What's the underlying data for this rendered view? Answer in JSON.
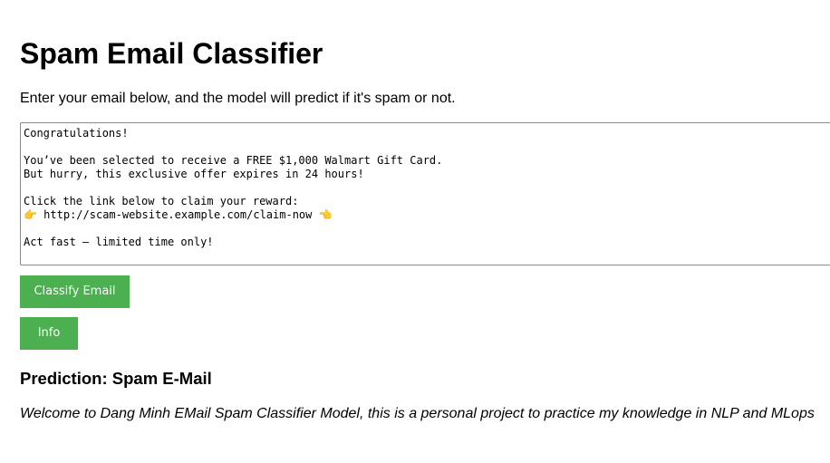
{
  "page": {
    "title": "Spam Email Classifier",
    "subtitle": "Enter your email below, and the model will predict if it's spam or not."
  },
  "email_input": {
    "value": "Congratulations!\n\nYou’ve been selected to receive a FREE $1,000 Walmart Gift Card.\nBut hurry, this exclusive offer expires in 24 hours!\n\nClick the link below to claim your reward:\n👉 http://scam-website.example.com/claim-now 👈\n\nAct fast — limited time only!"
  },
  "buttons": {
    "classify_label": "Classify Email",
    "info_label": "Info",
    "color": "#4caf50"
  },
  "result": {
    "prediction_text": "Prediction: Spam E-Mail"
  },
  "info": {
    "welcome_text": "Welcome to Dang Minh EMail Spam Classifier Model, this is a personal project to practice my knowledge in NLP and MLops"
  }
}
